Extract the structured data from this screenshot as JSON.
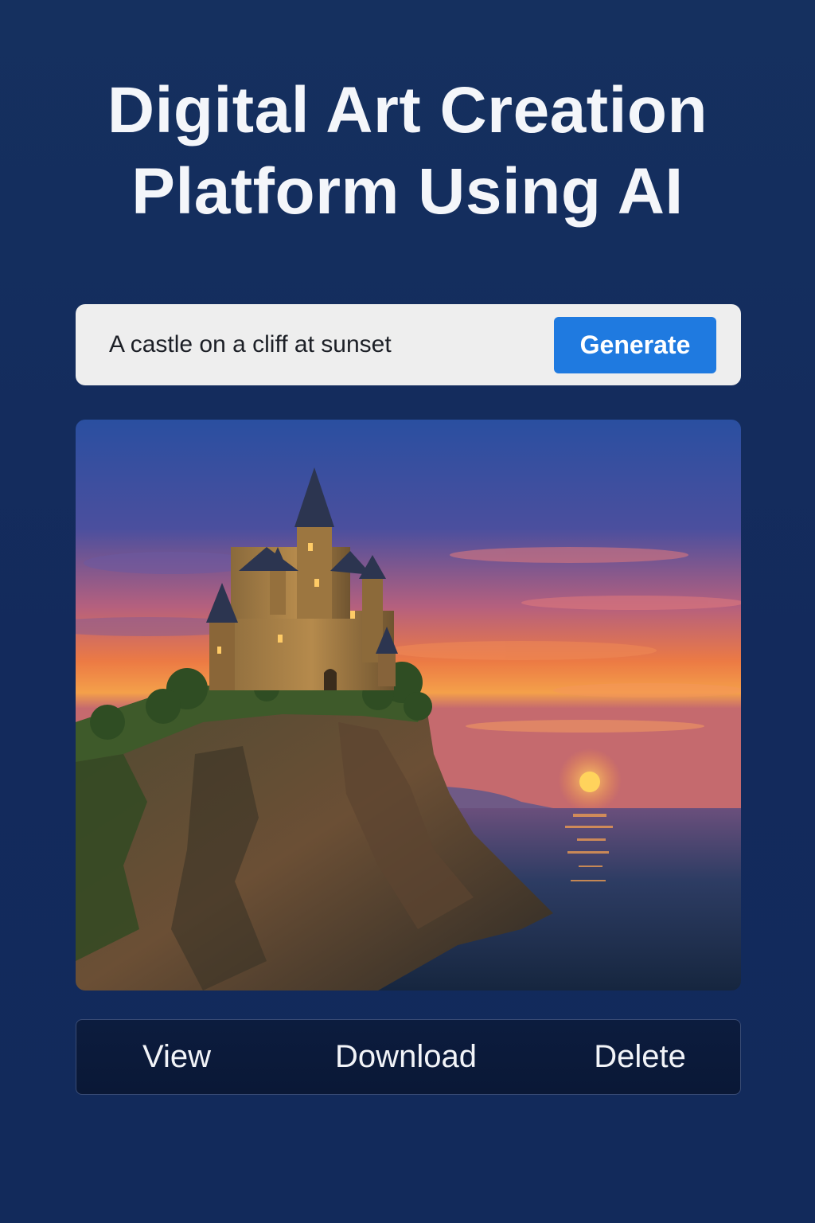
{
  "header": {
    "title_line1": "Digital Art Creation",
    "title_line2": "Platform Using AI"
  },
  "prompt": {
    "value": "A castle on a cliff at sunset",
    "generate_label": "Generate"
  },
  "artwork": {
    "subject": "castle-on-cliff-sunset-artwork"
  },
  "actions": {
    "view_label": "View",
    "download_label": "Download",
    "delete_label": "Delete"
  },
  "colors": {
    "background": "#132c5f",
    "accent": "#1f7ae0",
    "input_bg": "#eeeeee",
    "action_bar_bg": "#0b1a3a"
  }
}
